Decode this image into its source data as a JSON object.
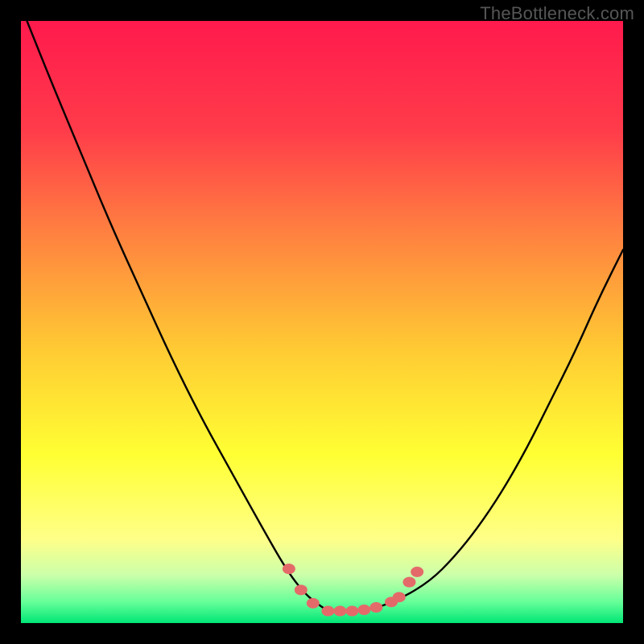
{
  "watermark": "TheBottleneck.com",
  "chart_data": {
    "type": "line",
    "title": "",
    "xlabel": "",
    "ylabel": "",
    "xlim": [
      0,
      100
    ],
    "ylim": [
      0,
      100
    ],
    "grid": false,
    "legend": false,
    "background_gradient": {
      "stops": [
        {
          "pos": 0.0,
          "color": "#ff1a4d"
        },
        {
          "pos": 0.18,
          "color": "#ff3b4a"
        },
        {
          "pos": 0.35,
          "color": "#ff8040"
        },
        {
          "pos": 0.55,
          "color": "#ffcc33"
        },
        {
          "pos": 0.72,
          "color": "#ffff33"
        },
        {
          "pos": 0.86,
          "color": "#ffff88"
        },
        {
          "pos": 0.92,
          "color": "#ccffaa"
        },
        {
          "pos": 0.965,
          "color": "#66ff99"
        },
        {
          "pos": 1.0,
          "color": "#00e676"
        }
      ]
    },
    "series": [
      {
        "name": "curve",
        "color": "#000000",
        "x": [
          1,
          5,
          10,
          15,
          20,
          25,
          30,
          35,
          40,
          44,
          47,
          49.5,
          51,
          53,
          56,
          59,
          63,
          68,
          72,
          76,
          80,
          84,
          88,
          92,
          96,
          100
        ],
        "y": [
          100,
          90,
          78,
          66,
          55,
          44,
          34,
          25,
          16,
          9,
          5,
          3,
          2,
          2,
          2,
          2.5,
          4,
          7,
          11,
          16,
          22,
          29,
          37,
          45,
          54,
          62
        ]
      }
    ],
    "markers": {
      "color": "#e46a6a",
      "points": [
        {
          "x": 44.5,
          "y": 9
        },
        {
          "x": 46.5,
          "y": 5.5
        },
        {
          "x": 48.5,
          "y": 3.3
        },
        {
          "x": 51.0,
          "y": 2.0
        },
        {
          "x": 53.0,
          "y": 2.0
        },
        {
          "x": 55.0,
          "y": 2.0
        },
        {
          "x": 57.0,
          "y": 2.2
        },
        {
          "x": 59.0,
          "y": 2.6
        },
        {
          "x": 61.5,
          "y": 3.5
        },
        {
          "x": 62.8,
          "y": 4.3
        },
        {
          "x": 64.5,
          "y": 6.8
        },
        {
          "x": 65.8,
          "y": 8.5
        }
      ]
    }
  }
}
